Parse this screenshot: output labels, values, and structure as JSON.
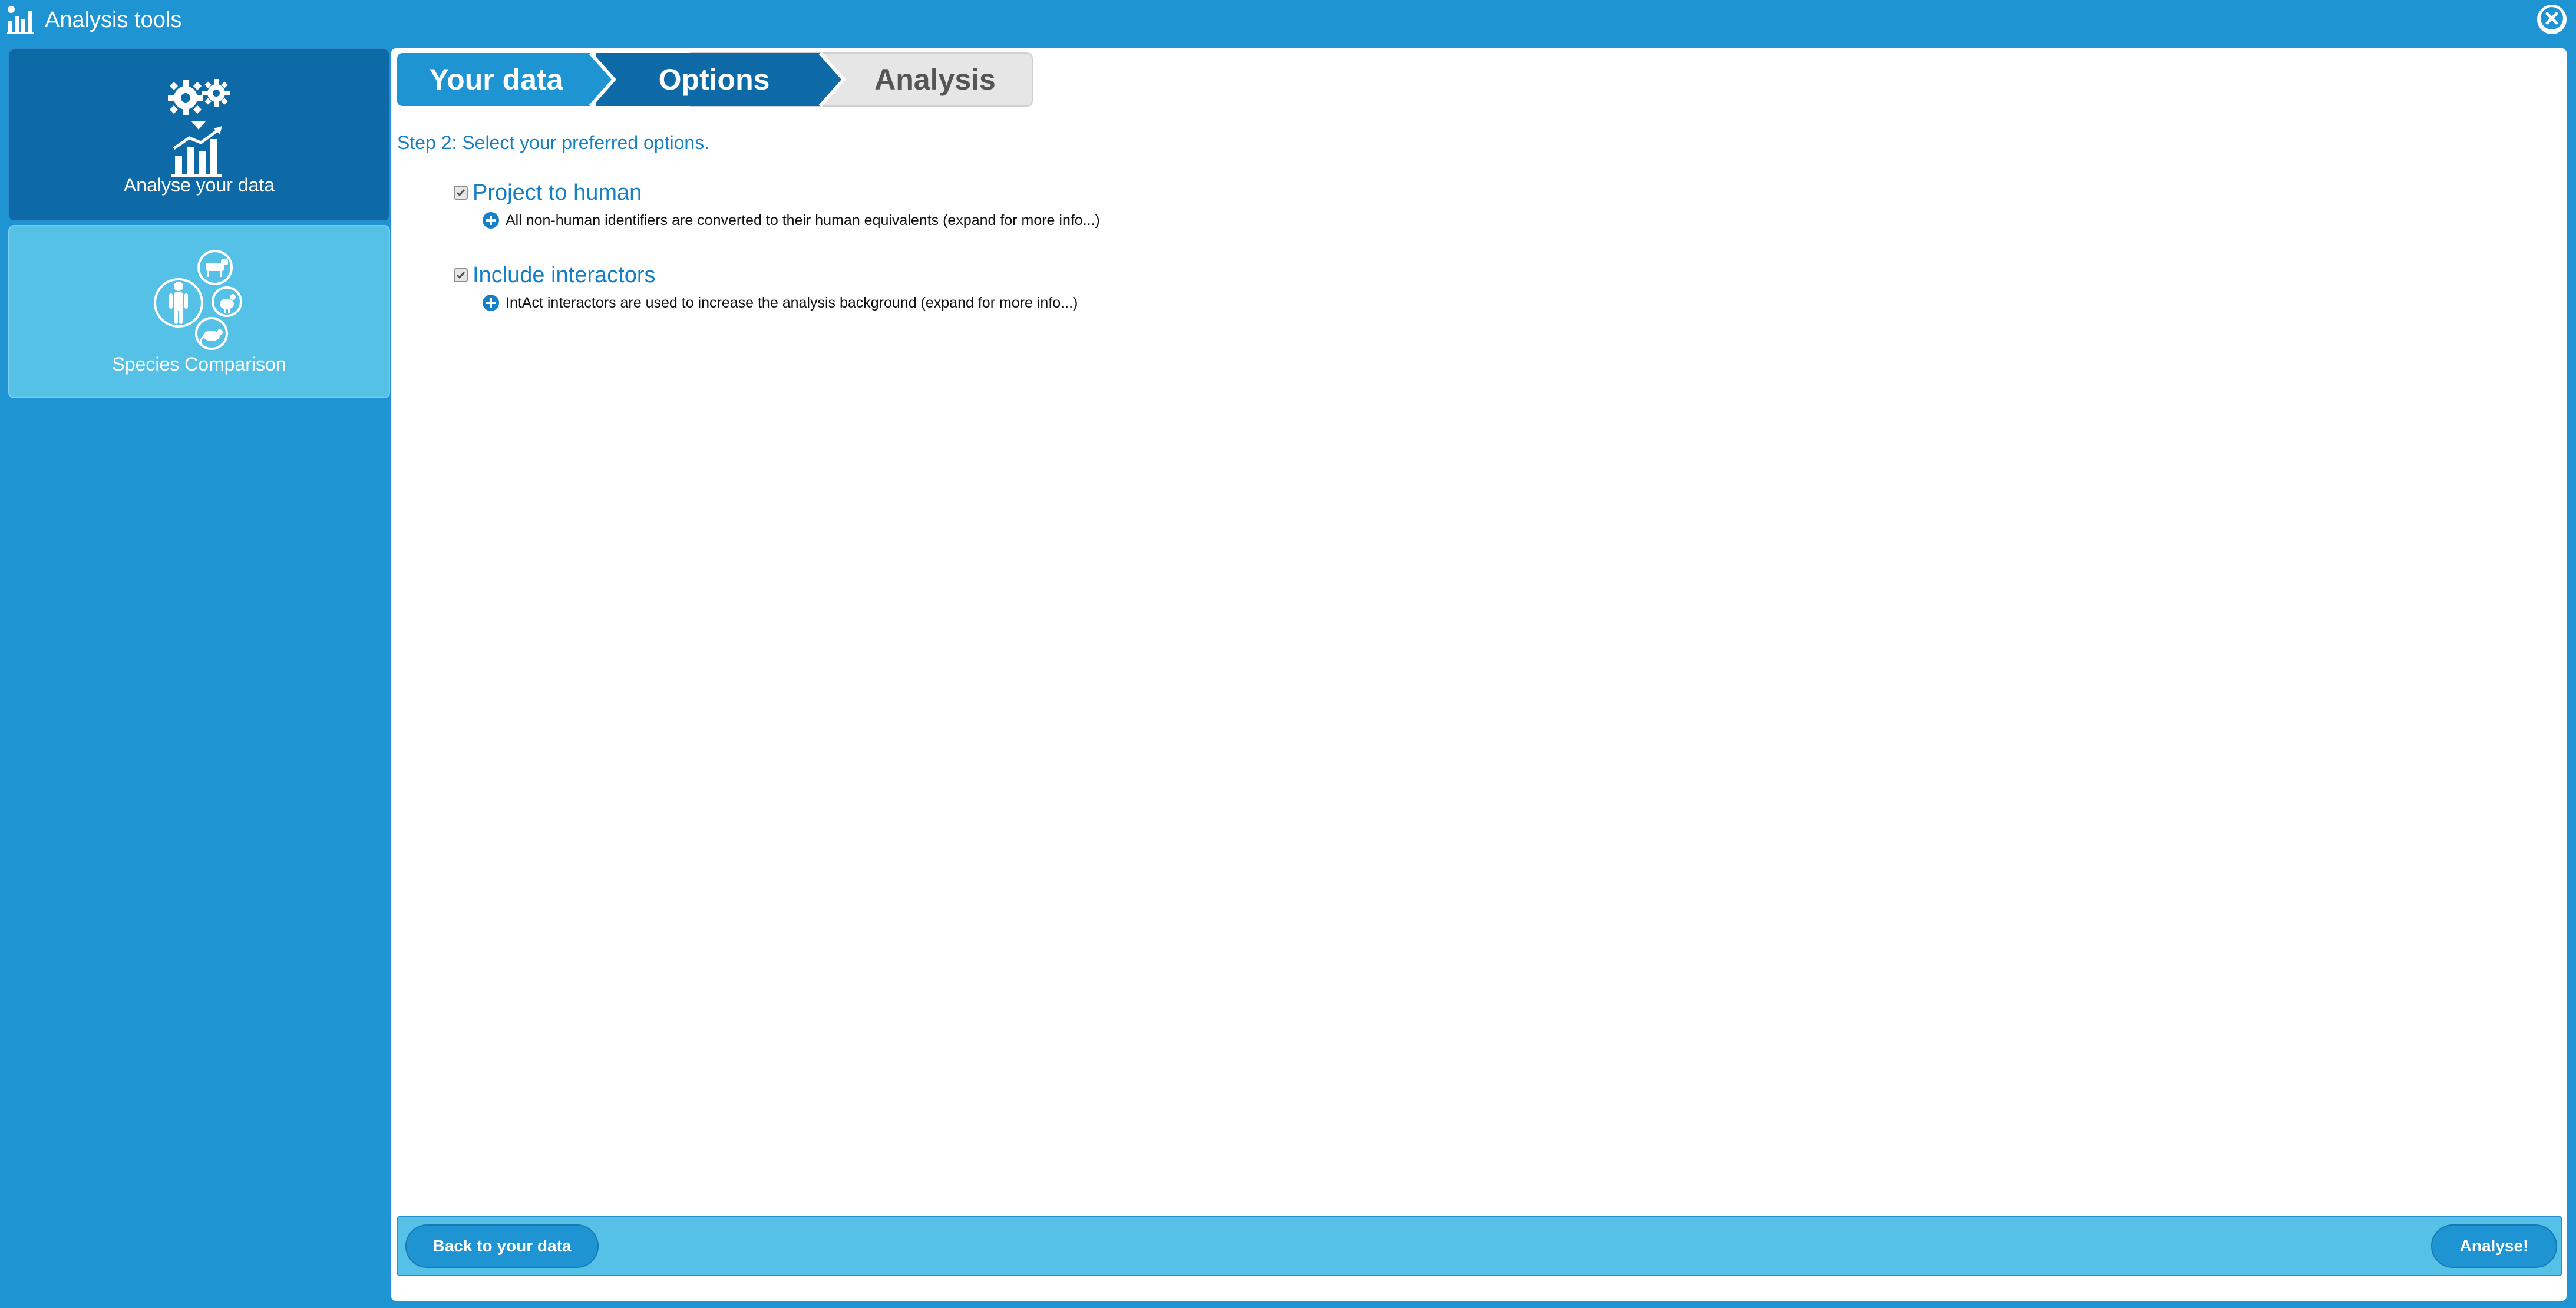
{
  "window": {
    "title": "Analysis tools",
    "icon": "chart-bars-icon",
    "close_icon": "close-icon"
  },
  "sidebar": {
    "items": [
      {
        "label": "Analyse your data",
        "icon": "gears-chart-icon",
        "active": true
      },
      {
        "label": "Species Comparison",
        "icon": "species-icon",
        "active": false
      }
    ]
  },
  "wizard": {
    "steps": [
      {
        "label": "Your data",
        "state": "done"
      },
      {
        "label": "Options",
        "state": "current"
      },
      {
        "label": "Analysis",
        "state": "pending"
      }
    ]
  },
  "main": {
    "heading": "Step 2: Select your preferred options.",
    "options": [
      {
        "title": "Project to human",
        "checked": true,
        "description": "All non-human identifiers are converted to their human equivalents (expand for more info...)"
      },
      {
        "title": "Include interactors",
        "checked": true,
        "description": "IntAct interactors are used to increase the analysis background (expand for more info...)"
      }
    ]
  },
  "footer": {
    "back_label": "Back to your data",
    "analyse_label": "Analyse!"
  },
  "colors": {
    "background": "#1f94d2",
    "active_sidebar": "#0e6aa6",
    "inactive_sidebar": "#56c1e6",
    "accent_text": "#1580c5",
    "step_pending": "#e6e6e6"
  }
}
